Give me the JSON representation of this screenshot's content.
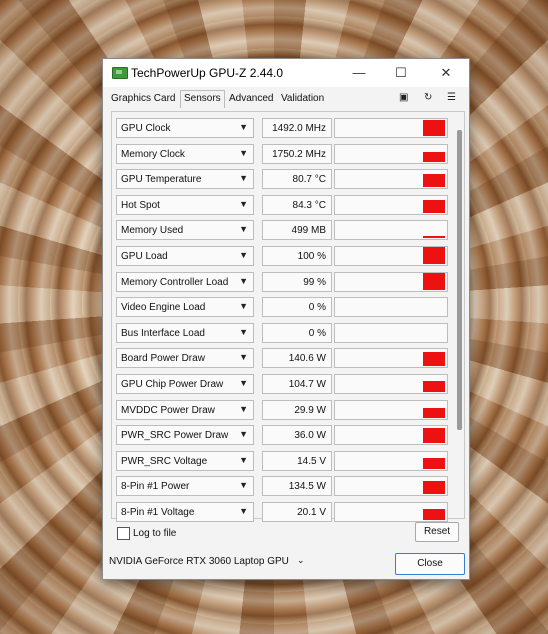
{
  "window": {
    "title": "TechPowerUp GPU-Z 2.44.0",
    "controls": {
      "minimize": "—",
      "maximize": "☐",
      "close": "✕"
    }
  },
  "tabs": [
    {
      "label": "Graphics Card",
      "active": false
    },
    {
      "label": "Sensors",
      "active": true
    },
    {
      "label": "Advanced",
      "active": false
    },
    {
      "label": "Validation",
      "active": false
    }
  ],
  "toolbar": {
    "camera_icon": "camera-icon",
    "refresh_icon": "refresh-icon",
    "menu_icon": "menu-icon"
  },
  "sensors": [
    {
      "name": "GPU Clock",
      "value": "1492.0 MHz",
      "level": 0.9
    },
    {
      "name": "Memory Clock",
      "value": "1750.2 MHz",
      "level": 0.55
    },
    {
      "name": "GPU Temperature",
      "value": "80.7 °C",
      "level": 0.7
    },
    {
      "name": "Hot Spot",
      "value": "84.3 °C",
      "level": 0.7
    },
    {
      "name": "Memory Used",
      "value": "499 MB",
      "level": 0.1
    },
    {
      "name": "GPU Load",
      "value": "100 %",
      "level": 1.0
    },
    {
      "name": "Memory Controller Load",
      "value": "99 %",
      "level": 1.0
    },
    {
      "name": "Video Engine Load",
      "value": "0 %",
      "level": 0.0
    },
    {
      "name": "Bus Interface Load",
      "value": "0 %",
      "level": 0.0
    },
    {
      "name": "Board Power Draw",
      "value": "140.6 W",
      "level": 0.75
    },
    {
      "name": "GPU Chip Power Draw",
      "value": "104.7 W",
      "level": 0.6
    },
    {
      "name": "MVDDC Power Draw",
      "value": "29.9 W",
      "level": 0.55
    },
    {
      "name": "PWR_SRC Power Draw",
      "value": "36.0 W",
      "level": 0.85
    },
    {
      "name": "PWR_SRC Voltage",
      "value": "14.5 V",
      "level": 0.6
    },
    {
      "name": "8-Pin #1 Power",
      "value": "134.5 W",
      "level": 0.7
    },
    {
      "name": "8-Pin #1 Voltage",
      "value": "20.1 V",
      "level": 0.6
    }
  ],
  "footer": {
    "log_to_file": "Log to file",
    "log_checked": false,
    "reset": "Reset",
    "gpu_selected": "NVIDIA GeForce RTX 3060 Laptop GPU",
    "close": "Close"
  },
  "colors": {
    "bar": "#ee1111"
  }
}
